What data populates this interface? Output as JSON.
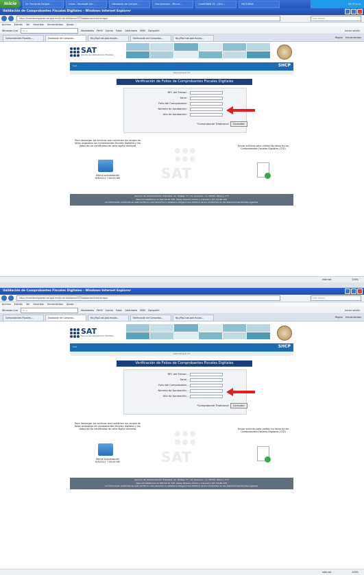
{
  "taskbar": {
    "start_label": "Inicio",
    "tasks": [
      "Dr. Fernando Delgad...",
      "Inbox - Microsoft Out...",
      "Validación de Compro...",
      "Documento1 - Micros...",
      "CorelDRAW X3 - [Gra...",
      "FACTURAS"
    ],
    "clock": "05:07 p.m."
  },
  "browser": {
    "title": "Validación de Comprobantes Fiscales Digitales - Windows Internet Explorer",
    "url": "https://tramitesdigitales.sat.gob.mx/Sicofi.ValidacionCFD/ValidacionUnitaria.aspx",
    "search_placeholder": "Live Search",
    "menu": [
      "Archivo",
      "Edición",
      "Ver",
      "Favoritos",
      "Herramientas",
      "Ayuda"
    ],
    "links": {
      "windows_live": "Windows Live",
      "bing": "Bing",
      "items": [
        "Novedades",
        "Perfil",
        "Correo",
        "Fotos",
        "Calendario",
        "MSN",
        "Compartir"
      ],
      "signin": "Iniciar sesión"
    },
    "tabs": [
      "Comprobantes Fiscales-...",
      "Validación de Comprob...",
      "ftp://ftp2.sat.gob.mx/asi...",
      "Verificación de Comproba...",
      "ftp://ftp2.sat.gob.mx/asi..."
    ],
    "commands": [
      "Página",
      "Herramientas"
    ],
    "status": {
      "zone": "Internet",
      "zoom": "100%"
    }
  },
  "site": {
    "logo_text": "SAT",
    "logo_subtitle": "Servicio de Administración Tributaria",
    "shcp": "SHCP",
    "salir": "Salir",
    "url_strip": "www.sat.gob.mx",
    "form_title": "Verificación de Folios de Comprobantes Fiscales Digitales",
    "fields": [
      "RFC del Emisor:",
      "Serie:",
      "Folio del Comprobante:",
      "Número de Aprobación:",
      "Año de Aprobación:"
    ],
    "tradicional_label": "*Comprobante Tradicional",
    "consultar": "Consultar",
    "left_text": "Para descargar los archivos que contienen los rangos de folios asignados de comprobantes fiscales digitales y los datos de los certificados de sello digital emitidos",
    "update_label": "Última Actualización",
    "update_date": "6/8/2011 7:00:00 AM",
    "right_text": "Enviar archivos para validar los folios de los Comprobantes Fiscales Digitales (CFD)",
    "watermark": "SAT",
    "footer": [
      "Servicio de Administración Tributaria, Av. Hidalgo 77, col. Guerrero, c.p. 06300, México, D.F.",
      "Atención telefónica 01 800 46 36 728, desde Estados Unidos y Canadá 1 877 44 88 728.",
      "La información publicada en este portal no crea derechos ni establece obligaciones distintos de los contenidos en las disposiciones fiscales vigentes."
    ]
  },
  "colors": {
    "accent": "#1d6bb5",
    "title_bar": "#1a3f7a",
    "arrow": "#e02020",
    "footer": "#5f6f80"
  }
}
